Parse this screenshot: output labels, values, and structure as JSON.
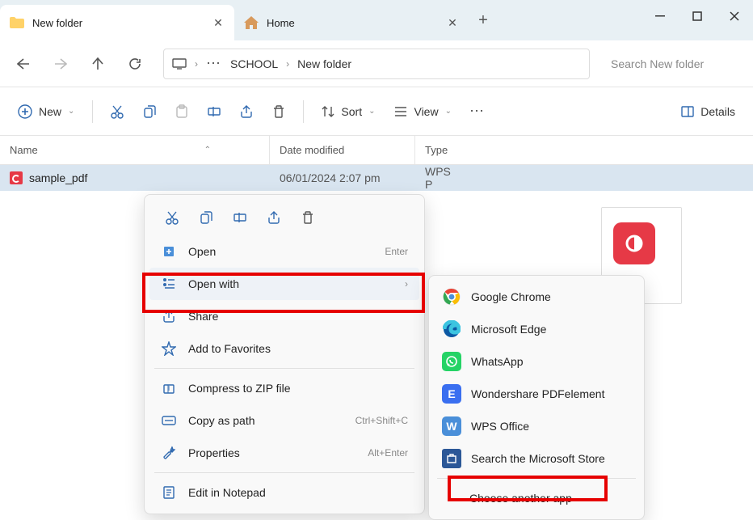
{
  "tabs": [
    {
      "title": "New folder",
      "icon": "folder"
    },
    {
      "title": "Home",
      "icon": "home"
    }
  ],
  "breadcrumb": {
    "parts": [
      "SCHOOL",
      "New folder"
    ]
  },
  "search": {
    "placeholder": "Search New folder"
  },
  "toolbar": {
    "new": "New",
    "sort": "Sort",
    "view": "View",
    "details": "Details"
  },
  "columns": {
    "name": "Name",
    "date": "Date modified",
    "type": "Type"
  },
  "file": {
    "name": "sample_pdf",
    "date": "06/01/2024 2:07 pm",
    "type": "WPS P"
  },
  "context": {
    "open": "Open",
    "open_accel": "Enter",
    "openwith": "Open with",
    "share": "Share",
    "fav": "Add to Favorites",
    "zip": "Compress to ZIP file",
    "copypath": "Copy as path",
    "copypath_accel": "Ctrl+Shift+C",
    "props": "Properties",
    "props_accel": "Alt+Enter",
    "notepad": "Edit in Notepad"
  },
  "submenu": {
    "chrome": "Google Chrome",
    "edge": "Microsoft Edge",
    "whatsapp": "WhatsApp",
    "pdfelement": "Wondershare PDFelement",
    "wps": "WPS Office",
    "store": "Search the Microsoft Store",
    "choose": "Choose another app"
  }
}
